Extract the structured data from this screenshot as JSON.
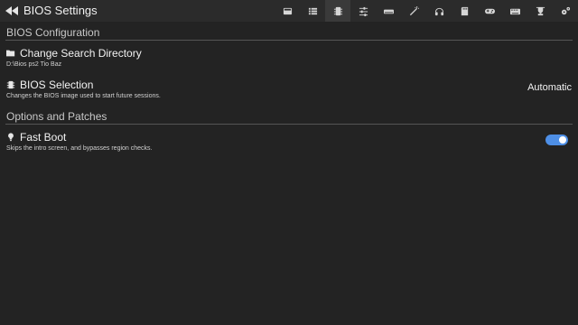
{
  "header": {
    "title": "BIOS Settings",
    "back_icon": "back-icon",
    "toolbar_icons": [
      "summary-icon",
      "list-icon",
      "chip-icon",
      "sliders-icon",
      "console-icon",
      "magic-wand-icon",
      "headphones-icon",
      "memory-card-icon",
      "gamepad-icon",
      "keyboard-icon",
      "trophy-icon",
      "gears-icon"
    ],
    "active_icon": "chip-icon"
  },
  "sections": {
    "bios_config": {
      "title": "BIOS Configuration"
    },
    "options": {
      "title": "Options and Patches"
    }
  },
  "settings": {
    "search_dir": {
      "icon": "folder-icon",
      "label": "Change Search Directory",
      "sub": "D:\\Bios ps2 Tio Baz"
    },
    "bios_selection": {
      "icon": "chip-icon",
      "label": "BIOS Selection",
      "sub": "Changes the BIOS image used to start future sessions.",
      "value": "Automatic"
    },
    "fast_boot": {
      "icon": "lightbulb-icon",
      "label": "Fast Boot",
      "sub": "Skips the intro screen, and bypasses region checks.",
      "enabled": true
    }
  },
  "colors": {
    "background": "#232323",
    "toggle_on": "#4e8fe6"
  }
}
